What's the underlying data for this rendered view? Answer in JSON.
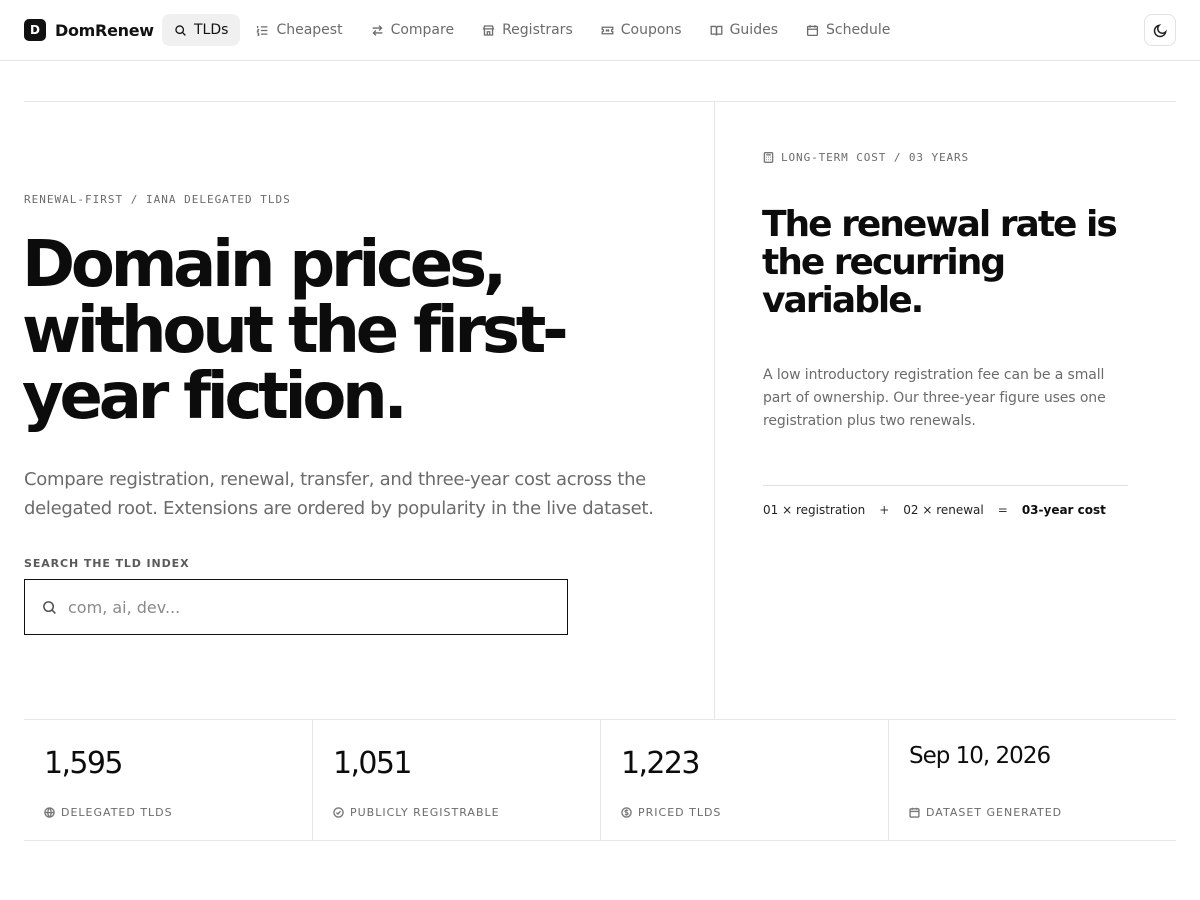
{
  "brand": {
    "mark": "D",
    "name": "DomRenew"
  },
  "nav": {
    "items": [
      {
        "label": "TLDs",
        "icon": "search-icon",
        "active": true
      },
      {
        "label": "Cheapest",
        "icon": "list-ordered-icon"
      },
      {
        "label": "Compare",
        "icon": "arrows-swap-icon"
      },
      {
        "label": "Registrars",
        "icon": "store-icon"
      },
      {
        "label": "Coupons",
        "icon": "ticket-icon"
      },
      {
        "label": "Guides",
        "icon": "book-open-icon"
      },
      {
        "label": "Schedule",
        "icon": "calendar-icon"
      }
    ],
    "theme_toggle_icon": "moon-icon"
  },
  "hero": {
    "eyebrow": "RENEWAL-FIRST / IANA DELEGATED TLDS",
    "headline": "Domain prices, without the first-year fiction.",
    "lede": "Compare registration, renewal, transfer, and three-year cost across the delegated root. Extensions are ordered by popularity in the live dataset.",
    "search": {
      "label": "SEARCH THE TLD INDEX",
      "placeholder": "com, ai, dev...",
      "value": ""
    }
  },
  "panel": {
    "kicker": "LONG-TERM COST / 03 YEARS",
    "kicker_icon": "calculator-icon",
    "title": "The renewal rate is the recurring variable.",
    "body": "A low introductory registration fee can be a small part of ownership. Our three-year figure uses one registration plus two renewals.",
    "formula": {
      "term1": "01 × registration",
      "plus": "+",
      "term2": "02 × renewal",
      "equals": "=",
      "result": "03-year cost"
    }
  },
  "stats": [
    {
      "value": "1,595",
      "label": "DELEGATED TLDS",
      "icon": "globe-icon"
    },
    {
      "value": "1,051",
      "label": "PUBLICLY REGISTRABLE",
      "icon": "check-circle-icon"
    },
    {
      "value": "1,223",
      "label": "PRICED TLDS",
      "icon": "dollar-circle-icon"
    },
    {
      "value": "Sep 10, 2026",
      "label": "DATASET GENERATED",
      "icon": "calendar-icon"
    }
  ],
  "colors": {
    "text": "#0c0c0c",
    "muted": "#6b6b6b",
    "border": "#e6e6e6",
    "active_nav_bg": "#f0f0f0"
  }
}
